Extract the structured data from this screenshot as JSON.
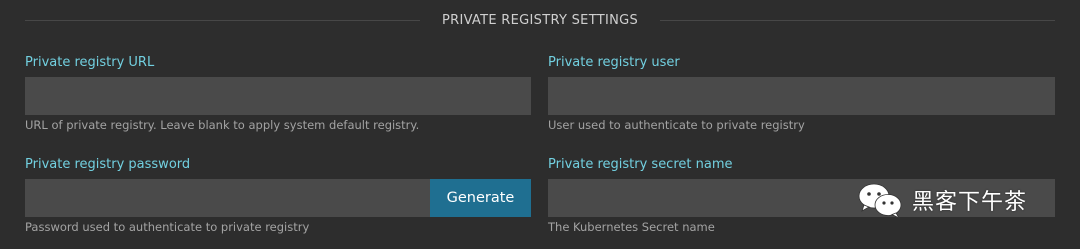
{
  "section": {
    "title": "PRIVATE REGISTRY SETTINGS"
  },
  "fields": {
    "registry_url": {
      "label": "Private registry URL",
      "value": "",
      "placeholder": "",
      "help": "URL of private registry. Leave blank to apply system default registry."
    },
    "registry_user": {
      "label": "Private registry user",
      "value": "",
      "placeholder": "",
      "help": "User used to authenticate to private registry"
    },
    "registry_password": {
      "label": "Private registry password",
      "value": "",
      "placeholder": "",
      "help": "Password used to authenticate to private registry",
      "generate_label": "Generate"
    },
    "secret_name": {
      "label": "Private registry secret name",
      "value": "",
      "placeholder": "",
      "help": "The Kubernetes Secret name"
    }
  },
  "watermark": {
    "icon": "wechat-logo-icon",
    "text": "黑客下午茶"
  },
  "colors": {
    "background": "#2d2d2d",
    "label": "#72d0e0",
    "input_bg": "#4a4a4a",
    "button_bg": "#1f6f91",
    "help_text": "#a3a3a3"
  }
}
